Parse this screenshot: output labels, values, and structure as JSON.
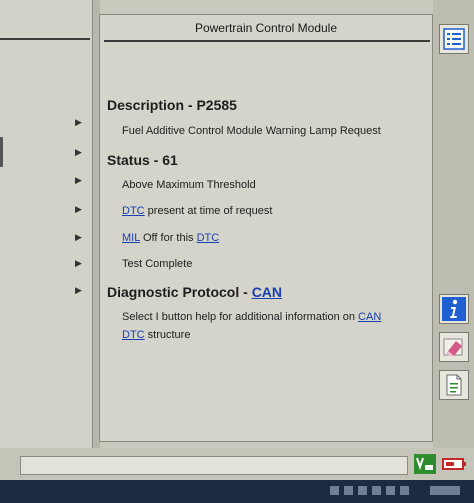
{
  "header": {
    "title": "Powertrain Control Module"
  },
  "description": {
    "label": "Description - P2585",
    "text": "Fuel Additive Control Module Warning Lamp Request"
  },
  "status": {
    "label": "Status - 61",
    "items": [
      {
        "text": "Above Maximum Threshold"
      },
      {
        "link": "DTC",
        "text": " present at time of request"
      },
      {
        "link": "MIL",
        "text_mid": " Off for this ",
        "link2": "DTC"
      },
      {
        "text": "Test Complete"
      }
    ]
  },
  "protocol": {
    "label": "Diagnostic Protocol - ",
    "label_link": "CAN",
    "help_line1": "Select I button help for additional information on ",
    "help_link1": "CAN",
    "help_link2": "DTC",
    "help_line2": " structure"
  },
  "toolbar": {
    "icons": [
      "list-icon",
      "info-icon",
      "eraser-icon",
      "document-icon"
    ]
  },
  "status_bar": {
    "icons": [
      "vehicle-comm-icon",
      "battery-icon"
    ]
  },
  "colors": {
    "link": "#1a3fb0",
    "info_button": "#1f5fd0",
    "comm_icon": "#2e8b2e",
    "battery_icon": "#c62828"
  }
}
